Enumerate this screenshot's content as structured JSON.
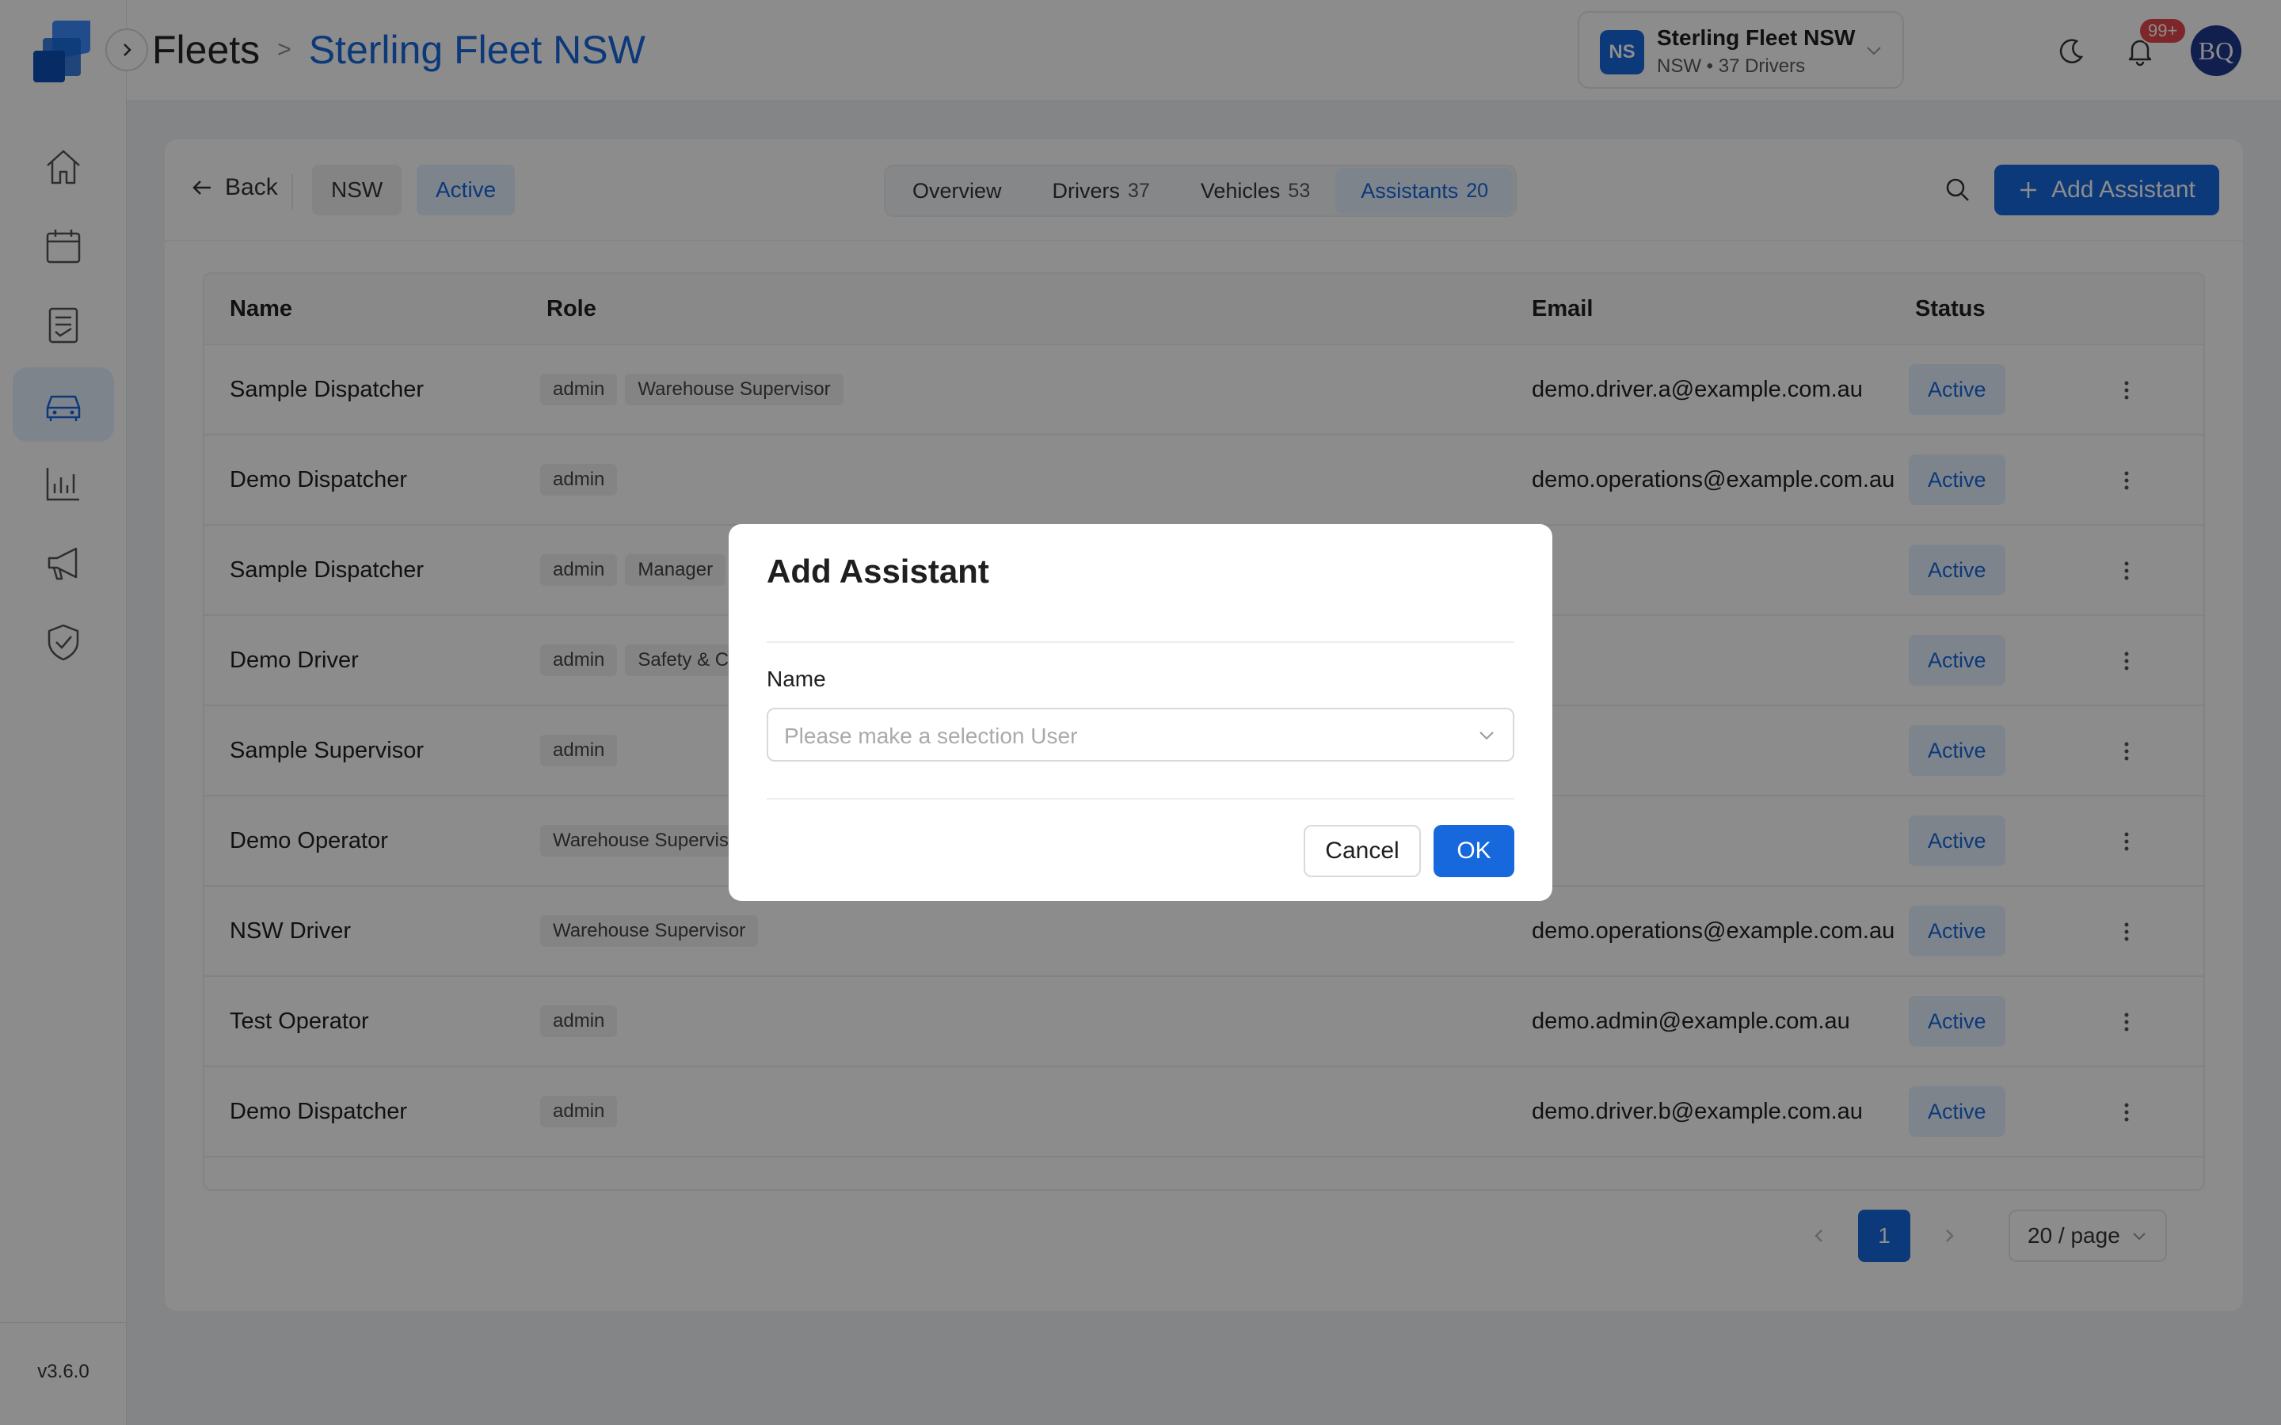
{
  "app": {
    "version": "v3.6.0",
    "accent": "#1668dc"
  },
  "sidebar": {
    "items": [
      {
        "name": "home",
        "icon": "home-icon"
      },
      {
        "name": "calendar",
        "icon": "calendar-icon"
      },
      {
        "name": "documents",
        "icon": "document-icon"
      },
      {
        "name": "fleets",
        "icon": "car-icon",
        "active": true
      },
      {
        "name": "reports",
        "icon": "bar-chart-icon"
      },
      {
        "name": "announcements",
        "icon": "megaphone-icon"
      },
      {
        "name": "compliance",
        "icon": "shield-check-icon"
      }
    ]
  },
  "header": {
    "breadcrumb_root": "Fleets",
    "breadcrumb_sep": ">",
    "breadcrumb_current": "Sterling Fleet NSW",
    "fleet": {
      "initials": "NS",
      "name": "Sterling Fleet NSW",
      "sub": "NSW • 37 Drivers"
    },
    "notifications": "99+",
    "user_initials": "BQ"
  },
  "toolbar": {
    "back_label": "Back",
    "region_tag": "NSW",
    "status_tag": "Active",
    "tabs": [
      {
        "label": "Overview",
        "count": ""
      },
      {
        "label": "Drivers",
        "count": "37"
      },
      {
        "label": "Vehicles",
        "count": "53"
      },
      {
        "label": "Assistants",
        "count": "20",
        "active": true
      }
    ],
    "add_label": "Add Assistant"
  },
  "table": {
    "headers": {
      "name": "Name",
      "role": "Role",
      "email": "Email",
      "status": "Status"
    },
    "rows": [
      {
        "name": "Sample Dispatcher",
        "roles": [
          "admin",
          "Warehouse Supervisor"
        ],
        "email": "demo.driver.a@example.com.au",
        "status": "Active"
      },
      {
        "name": "Demo Dispatcher",
        "roles": [
          "admin"
        ],
        "email": "demo.operations@example.com.au",
        "status": "Active"
      },
      {
        "name": "Sample Dispatcher",
        "roles": [
          "admin",
          "Manager"
        ],
        "email": "",
        "status": "Active"
      },
      {
        "name": "Demo Driver",
        "roles": [
          "admin",
          "Safety & C"
        ],
        "email": "",
        "status": "Active"
      },
      {
        "name": "Sample Supervisor",
        "roles": [
          "admin"
        ],
        "email": "",
        "status": "Active"
      },
      {
        "name": "Demo Operator",
        "roles": [
          "Warehouse Supervis"
        ],
        "email": "",
        "status": "Active"
      },
      {
        "name": "NSW Driver",
        "roles": [
          "Warehouse Supervisor"
        ],
        "email": "demo.operations@example.com.au",
        "status": "Active"
      },
      {
        "name": "Test Operator",
        "roles": [
          "admin"
        ],
        "email": "demo.admin@example.com.au",
        "status": "Active"
      },
      {
        "name": "Demo Dispatcher",
        "roles": [
          "admin"
        ],
        "email": "demo.driver.b@example.com.au",
        "status": "Active"
      }
    ]
  },
  "pagination": {
    "current": "1",
    "page_size": "20 / page"
  },
  "modal": {
    "title": "Add Assistant",
    "field_label": "Name",
    "placeholder": "Please make a selection User",
    "cancel": "Cancel",
    "ok": "OK"
  }
}
